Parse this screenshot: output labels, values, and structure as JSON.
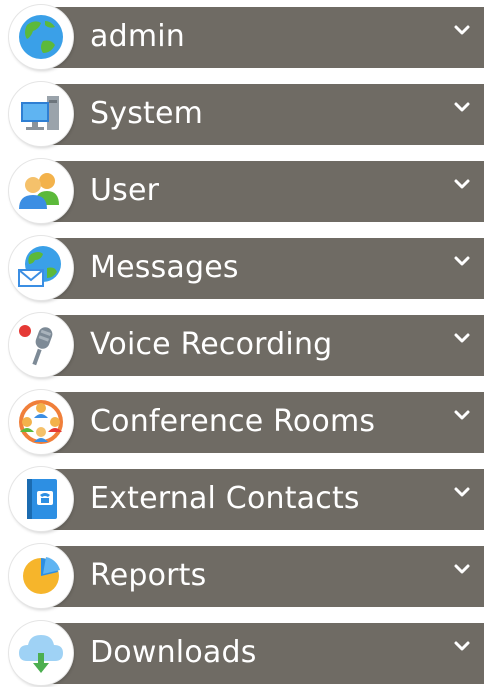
{
  "menu": {
    "items": [
      {
        "label": "admin",
        "icon": "globe-icon"
      },
      {
        "label": "System",
        "icon": "computer-icon"
      },
      {
        "label": "User",
        "icon": "users-icon"
      },
      {
        "label": "Messages",
        "icon": "messages-globe-icon"
      },
      {
        "label": "Voice Recording",
        "icon": "microphone-icon"
      },
      {
        "label": "Conference Rooms",
        "icon": "conference-icon"
      },
      {
        "label": "External Contacts",
        "icon": "contacts-book-icon"
      },
      {
        "label": "Reports",
        "icon": "pie-chart-icon"
      },
      {
        "label": "Downloads",
        "icon": "cloud-download-icon"
      }
    ]
  },
  "colors": {
    "bar": "#6f6b64",
    "text": "#ffffff",
    "background": "#ffffff"
  }
}
